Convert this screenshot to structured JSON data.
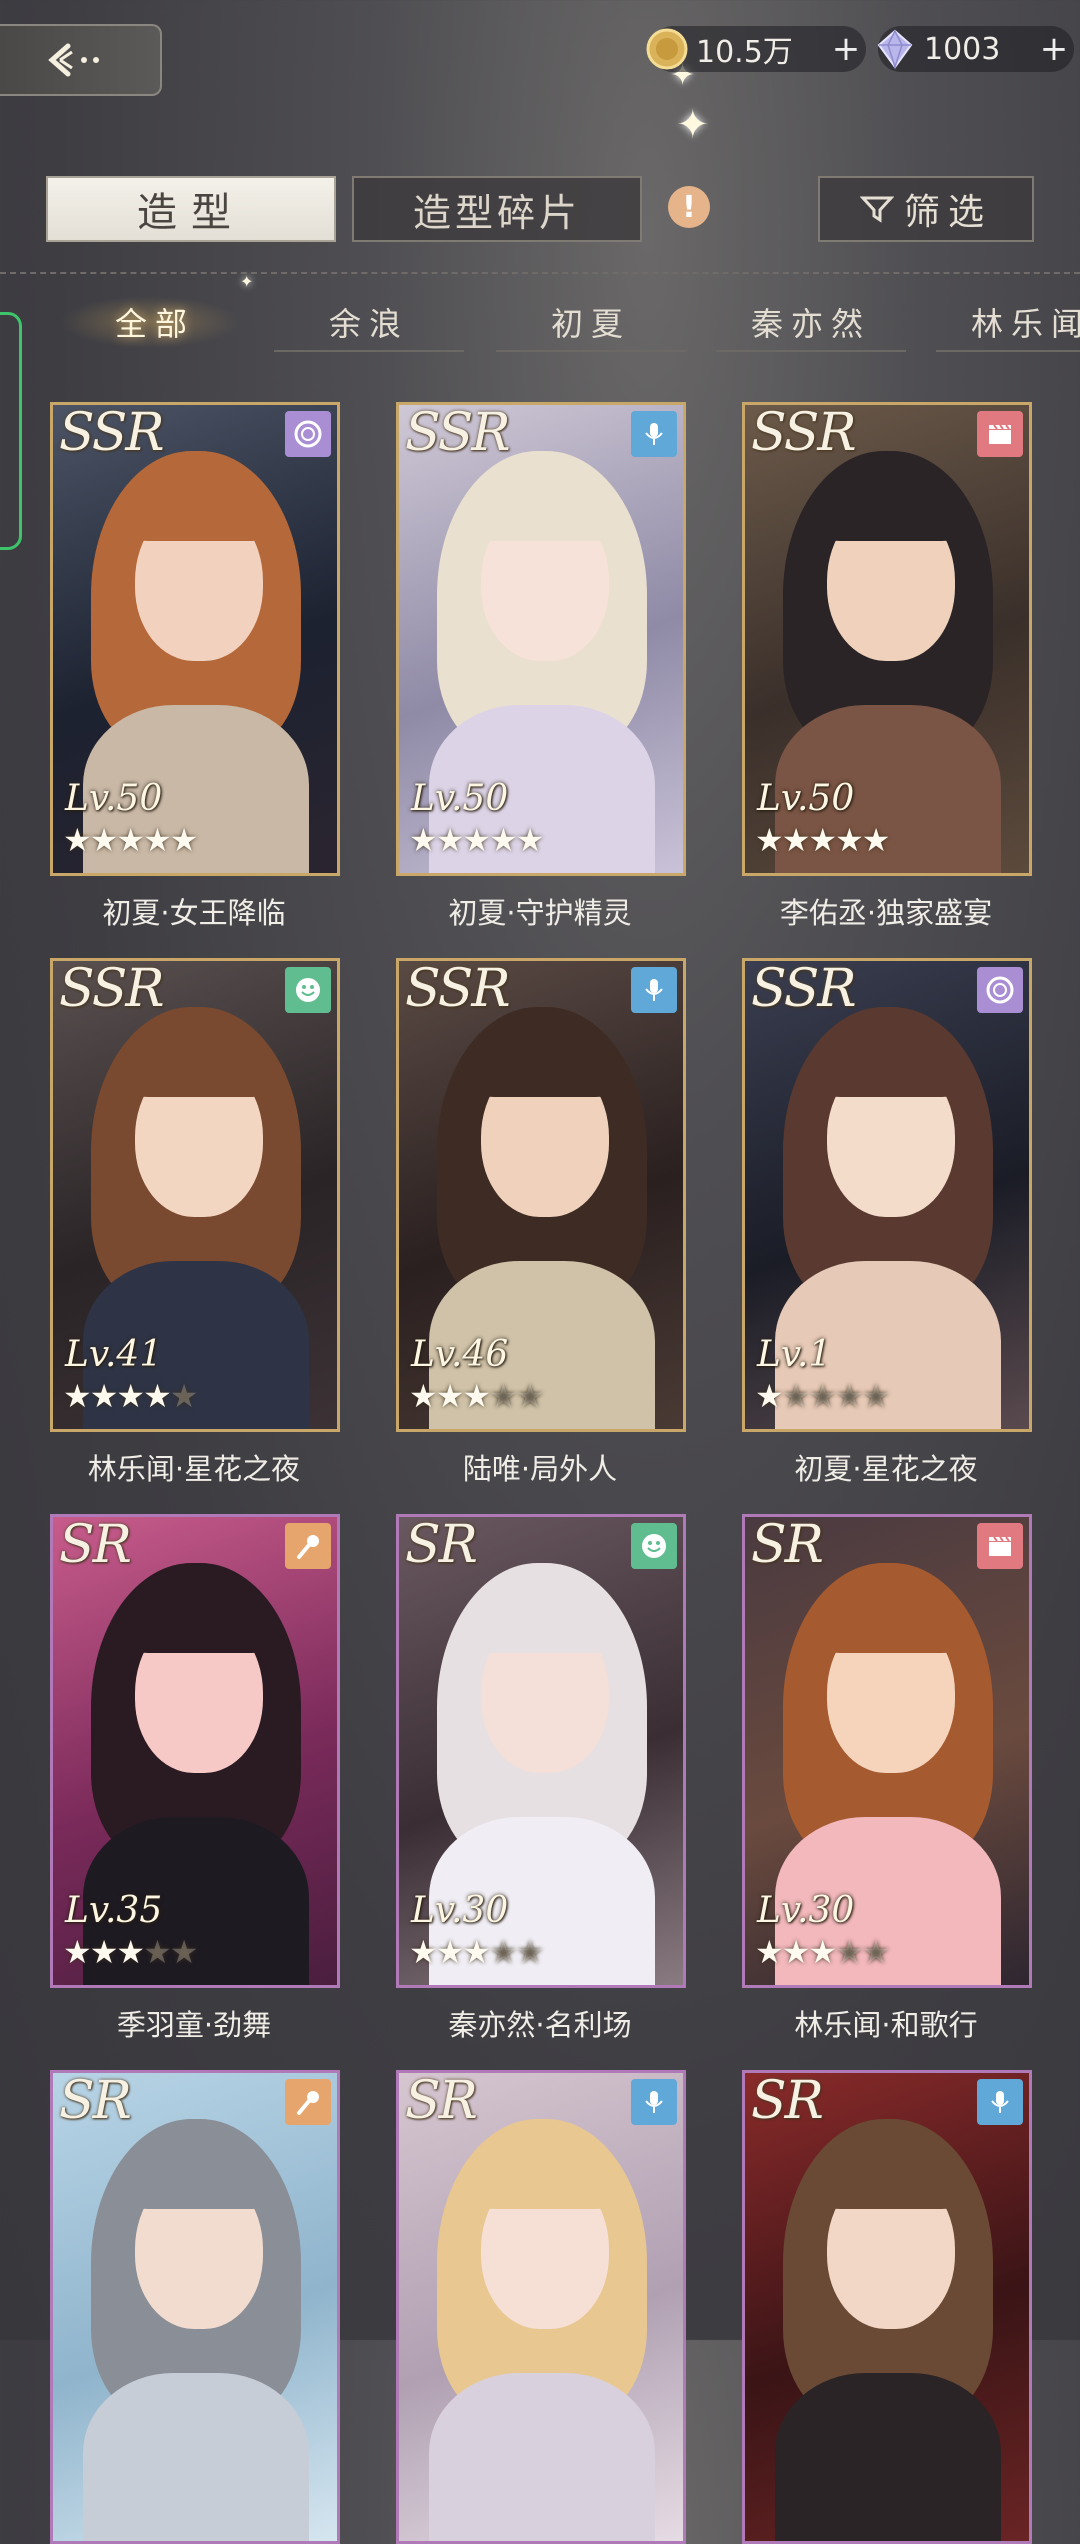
{
  "currency": {
    "gold_value": "10.5万",
    "gem_value": "1003",
    "plus": "+"
  },
  "tabs": {
    "outfit": "造型",
    "fragments": "造型碎片",
    "alert": "!",
    "filter": "筛选"
  },
  "characters": [
    "全部",
    "余浪",
    "初夏",
    "秦亦然",
    "林乐闻"
  ],
  "cards": [
    {
      "rarity": "SSR",
      "level": "Lv.50",
      "stars": 5,
      "name": "初夏·女王降临",
      "badge_icon": "record-icon",
      "badge_color": "#a98ed3"
    },
    {
      "rarity": "SSR",
      "level": "Lv.50",
      "stars": 5,
      "name": "初夏·守护精灵",
      "badge_icon": "mic-icon",
      "badge_color": "#5fa8d8"
    },
    {
      "rarity": "SSR",
      "level": "Lv.50",
      "stars": 5,
      "name": "李佑丞·独家盛宴",
      "badge_icon": "clapper-icon",
      "badge_color": "#e07a80"
    },
    {
      "rarity": "SSR",
      "level": "Lv.41",
      "stars": 4,
      "name": "林乐闻·星花之夜",
      "badge_icon": "smile-icon",
      "badge_color": "#5fbd8f"
    },
    {
      "rarity": "SSR",
      "level": "Lv.46",
      "stars": 3,
      "name": "陆唯·局外人",
      "badge_icon": "mic-icon",
      "badge_color": "#5fa8d8"
    },
    {
      "rarity": "SSR",
      "level": "Lv.1",
      "stars": 1,
      "name": "初夏·星花之夜",
      "badge_icon": "record-icon",
      "badge_color": "#a98ed3"
    },
    {
      "rarity": "SR",
      "level": "Lv.35",
      "stars": 3,
      "name": "季羽童·劲舞",
      "badge_icon": "pen-mic-icon",
      "badge_color": "#e6a56c"
    },
    {
      "rarity": "SR",
      "level": "Lv.30",
      "stars": 3,
      "name": "秦亦然·名利场",
      "badge_icon": "smile-icon",
      "badge_color": "#5fbd8f"
    },
    {
      "rarity": "SR",
      "level": "Lv.30",
      "stars": 3,
      "name": "林乐闻·和歌行",
      "badge_icon": "clapper-icon",
      "badge_color": "#e07a80"
    },
    {
      "rarity": "SR",
      "level": "",
      "stars": 0,
      "name": "",
      "badge_icon": "pen-mic-icon",
      "badge_color": "#e6a56c"
    },
    {
      "rarity": "SR",
      "level": "",
      "stars": 0,
      "name": "",
      "badge_icon": "mic-icon",
      "badge_color": "#5fa8d8"
    },
    {
      "rarity": "SR",
      "level": "",
      "stars": 0,
      "name": "",
      "badge_icon": "mic-icon",
      "badge_color": "#5fa8d8"
    }
  ]
}
